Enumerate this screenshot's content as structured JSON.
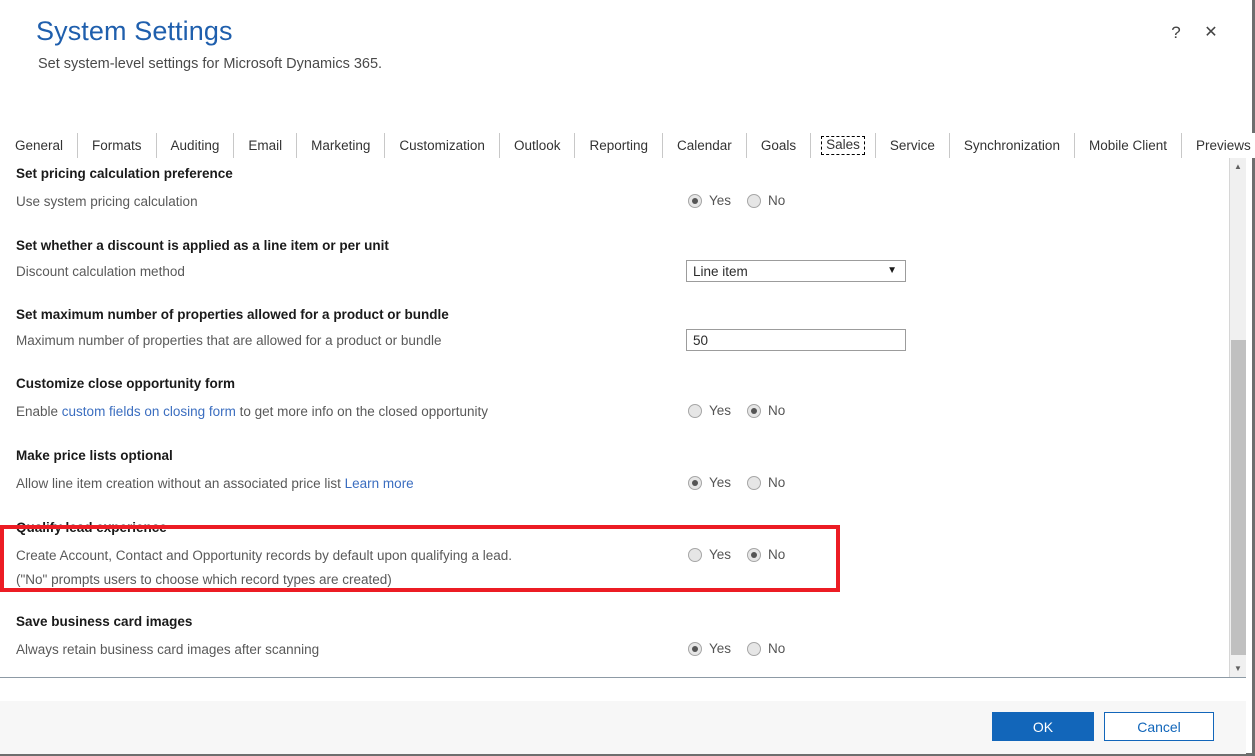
{
  "window": {
    "title": "System Settings",
    "subtitle": "Set system-level settings for Microsoft Dynamics 365.",
    "help_icon": "?",
    "close_icon": "✕"
  },
  "tabs": [
    {
      "label": "General",
      "active": false
    },
    {
      "label": "Formats",
      "active": false
    },
    {
      "label": "Auditing",
      "active": false
    },
    {
      "label": "Email",
      "active": false
    },
    {
      "label": "Marketing",
      "active": false
    },
    {
      "label": "Customization",
      "active": false
    },
    {
      "label": "Outlook",
      "active": false
    },
    {
      "label": "Reporting",
      "active": false
    },
    {
      "label": "Calendar",
      "active": false
    },
    {
      "label": "Goals",
      "active": false
    },
    {
      "label": "Sales",
      "active": true
    },
    {
      "label": "Service",
      "active": false
    },
    {
      "label": "Synchronization",
      "active": false
    },
    {
      "label": "Mobile Client",
      "active": false
    },
    {
      "label": "Previews",
      "active": false
    }
  ],
  "settings": [
    {
      "heading": "Set pricing calculation preference",
      "description": "Use system pricing calculation",
      "control": "radio",
      "yes_label": "Yes",
      "no_label": "No",
      "selected": "Yes"
    },
    {
      "heading": "Set whether a discount is applied as a line item or per unit",
      "description": "Discount calculation method",
      "control": "select",
      "value": "Line item",
      "caret": "▼"
    },
    {
      "heading": "Set maximum number of properties allowed for a product or bundle",
      "description": "Maximum number of properties that are allowed for a product or bundle",
      "control": "textbox",
      "value": "50"
    },
    {
      "heading": "Customize close opportunity form",
      "description_pre": "Enable ",
      "description_link": "custom fields on closing form",
      "description_post": " to get more info on the closed opportunity",
      "control": "radio",
      "yes_label": "Yes",
      "no_label": "No",
      "selected": "No",
      "highlighted": true
    },
    {
      "heading": "Make price lists optional",
      "description_pre": "Allow line item creation without an associated price list ",
      "description_link": "Learn more",
      "description_post": "",
      "control": "radio",
      "yes_label": "Yes",
      "no_label": "No",
      "selected": "Yes"
    },
    {
      "heading": "Qualify lead experience",
      "description": "Create Account, Contact and Opportunity records by default upon qualifying a lead.",
      "description2": "(\"No\" prompts users to choose which record types are created)",
      "control": "radio",
      "yes_label": "Yes",
      "no_label": "No",
      "selected": "No"
    },
    {
      "heading": "Save business card images",
      "description": "Always retain business card images after scanning",
      "control": "radio",
      "yes_label": "Yes",
      "no_label": "No",
      "selected": "Yes"
    }
  ],
  "scrollbar": {
    "up_arrow": "▲",
    "down_arrow": "▼"
  },
  "footer": {
    "ok_label": "OK",
    "cancel_label": "Cancel"
  },
  "colors": {
    "title_blue": "#1f5fad",
    "link_blue": "#3b6ec0",
    "primary_button": "#1266ba",
    "highlight_red": "#ec1c24"
  }
}
